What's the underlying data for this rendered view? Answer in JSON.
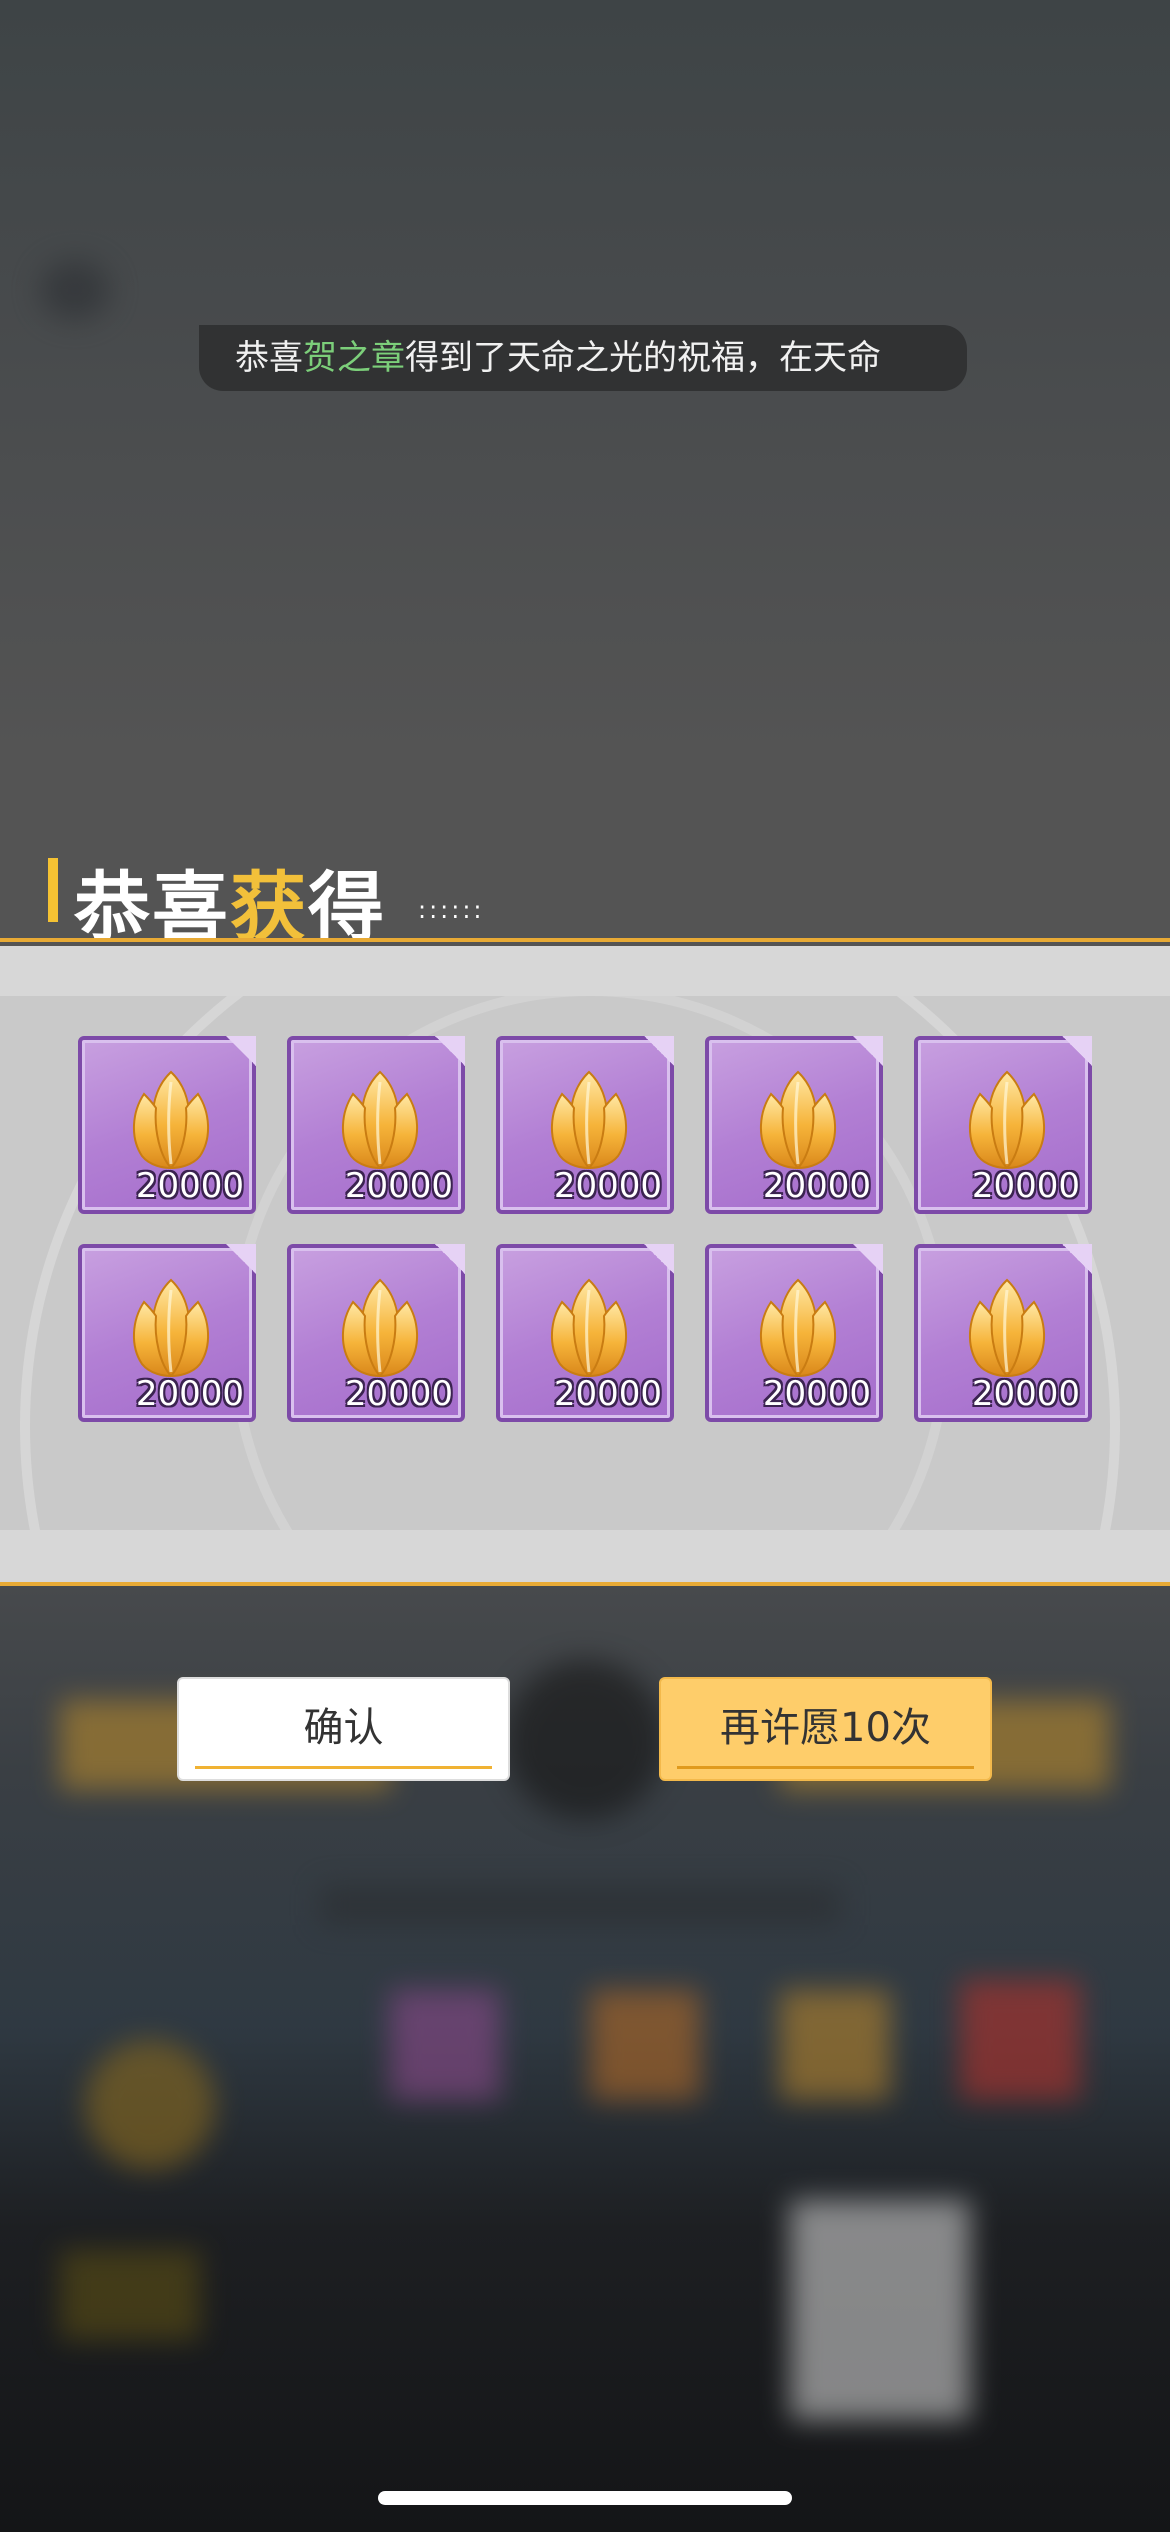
{
  "announcement": {
    "prefix": "恭喜",
    "player": "贺之章",
    "message": "得到了天命之光的祝福，在天命"
  },
  "reward_title": {
    "part1": "恭喜",
    "part2": "获",
    "part3": "得",
    "dots": "::::::"
  },
  "rewards": [
    {
      "icon": "golden-flower-icon",
      "quantity": "20000"
    },
    {
      "icon": "golden-flower-icon",
      "quantity": "20000"
    },
    {
      "icon": "golden-flower-icon",
      "quantity": "20000"
    },
    {
      "icon": "golden-flower-icon",
      "quantity": "20000"
    },
    {
      "icon": "golden-flower-icon",
      "quantity": "20000"
    },
    {
      "icon": "golden-flower-icon",
      "quantity": "20000"
    },
    {
      "icon": "golden-flower-icon",
      "quantity": "20000"
    },
    {
      "icon": "golden-flower-icon",
      "quantity": "20000"
    },
    {
      "icon": "golden-flower-icon",
      "quantity": "20000"
    },
    {
      "icon": "golden-flower-icon",
      "quantity": "20000"
    }
  ],
  "buttons": {
    "confirm": "确认",
    "wish_again": "再许愿10次"
  },
  "colors": {
    "accent_gold": "#f2c03a",
    "item_purple": "#b27fd4",
    "player_green": "#7ccf7a",
    "button_yellow": "#fecd6a"
  }
}
